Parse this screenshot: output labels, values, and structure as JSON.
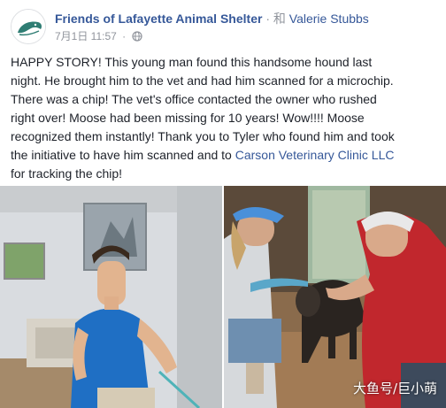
{
  "post": {
    "page_name": "Friends of Lafayette Animal Shelter",
    "with_text": "· 和",
    "tagged_name": "Valerie Stubbs",
    "date": "7月1日 11:57",
    "separator": "·",
    "body_lines": [
      "HAPPY STORY! This young man found this handsome hound last",
      "night. He brought him to the vet and had him scanned for a microchip.",
      "There was a chip! The vet's office contacted the owner who rushed",
      "right over! Moose had been missing for 10 years! Wow!!!! Moose",
      "recognized them instantly! Thank you to Tyler who found him and took"
    ],
    "body_line6_prefix": "the initiative to have him scanned and to ",
    "body_link": "Carson Veterinary Clinic LLC",
    "body_line7": "for tracking the chip!"
  },
  "icons": {
    "avatar": "shelter-logo-icon",
    "privacy": "globe-icon"
  },
  "photos": {
    "left": "young-man-with-dog-photo",
    "right": "owners-reunited-with-dog-photo"
  },
  "watermark": "大鱼号/巨小萌",
  "colors": {
    "link": "#365899",
    "text": "#1d2129",
    "meta": "#90949c"
  }
}
